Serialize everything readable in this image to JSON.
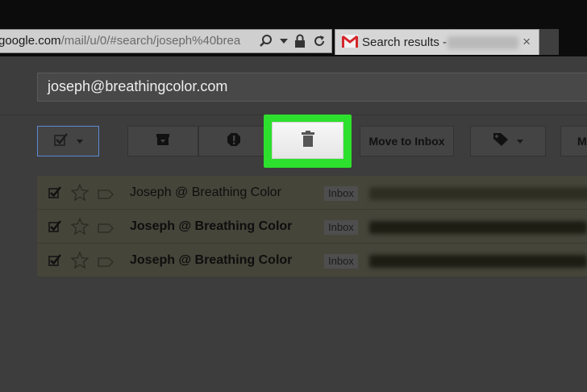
{
  "browser": {
    "url": {
      "domain": "google.com",
      "path": "/mail/u/0/#search/joseph%40brea"
    },
    "tab": {
      "title": "Search results -",
      "close_glyph": "×"
    }
  },
  "search": {
    "query": "joseph@breathingcolor.com"
  },
  "toolbar": {
    "move_to_inbox_label": "Move to Inbox",
    "more_label": "M"
  },
  "messages": [
    {
      "sender": "Joseph @ Breathing Color",
      "label": "Inbox",
      "unread": false
    },
    {
      "sender": "Joseph @ Breathing Color",
      "label": "Inbox",
      "unread": true
    },
    {
      "sender": "Joseph @ Breathing Color",
      "label": "Inbox",
      "unread": true
    }
  ],
  "colors": {
    "highlight": "#2de02d",
    "row_bg": "#45453a",
    "select_border": "#5b8ad6"
  }
}
